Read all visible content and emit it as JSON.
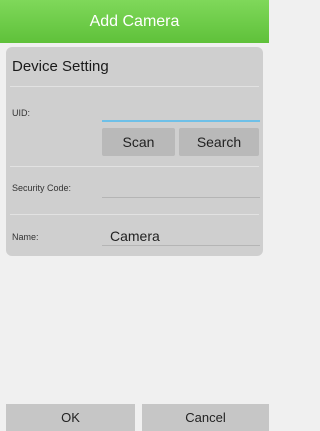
{
  "header": {
    "title": "Add Camera"
  },
  "device_setting": {
    "title": "Device Setting",
    "uid": {
      "label": "UID:",
      "value": ""
    },
    "scan_label": "Scan",
    "search_label": "Search",
    "security_code": {
      "label": "Security Code:",
      "value": ""
    },
    "name": {
      "label": "Name:",
      "value": "Camera"
    }
  },
  "footer": {
    "ok_label": "OK",
    "cancel_label": "Cancel"
  },
  "colors": {
    "header_green": "#5fc13a",
    "uid_focus_underline": "#6ec0e8",
    "card_background": "#cfcfcf"
  }
}
